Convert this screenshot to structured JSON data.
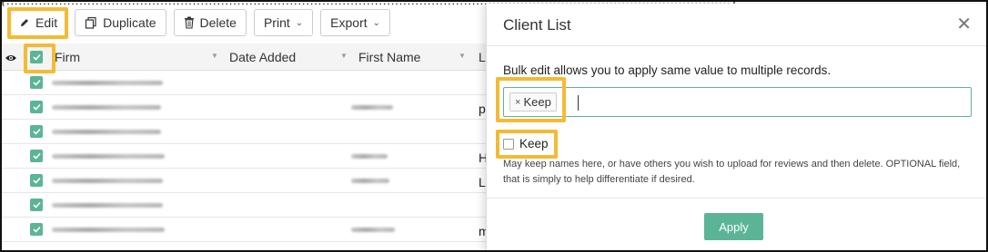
{
  "toolbar": {
    "edit_label": "Edit",
    "duplicate_label": "Duplicate",
    "delete_label": "Delete",
    "print_label": "Print",
    "export_label": "Export"
  },
  "grid": {
    "columns": [
      "Firm",
      "Date Added",
      "First Name",
      "L"
    ],
    "rows": [
      {
        "checked": true,
        "last_initial": ""
      },
      {
        "checked": true,
        "last_initial": "p"
      },
      {
        "checked": true,
        "last_initial": ""
      },
      {
        "checked": true,
        "last_initial": "H"
      },
      {
        "checked": true,
        "last_initial": "L"
      },
      {
        "checked": true,
        "last_initial": ""
      },
      {
        "checked": true,
        "last_initial": "m"
      }
    ]
  },
  "panel": {
    "title": "Client List",
    "info": "Bulk edit allows you to apply same value to multiple records.",
    "tag_label": "Keep",
    "checkbox_label": "Keep",
    "checkbox_checked": false,
    "help_text": "May keep names here, or have others you wish to upload for reviews and then delete. OPTIONAL field, that is simply to help differentiate if desired.",
    "apply_label": "Apply"
  },
  "colors": {
    "accent": "#5cb497",
    "highlight": "#f3bb35"
  }
}
